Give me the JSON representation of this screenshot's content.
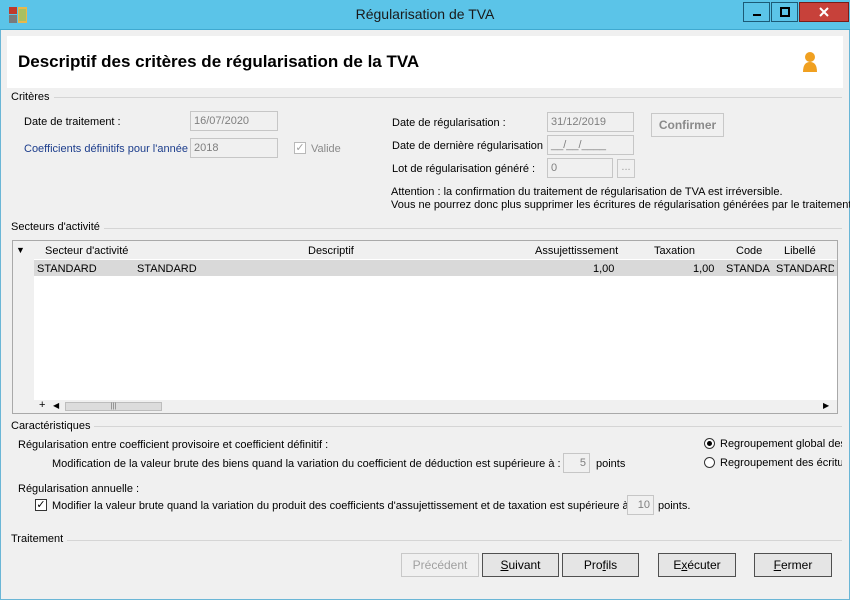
{
  "window": {
    "title": "Régularisation de TVA",
    "minimize_glyph": "▁",
    "maximize_glyph": "□",
    "close_glyph": "✕"
  },
  "header": {
    "title": "Descriptif des critères de régularisation de la TVA",
    "icon": "user-icon"
  },
  "criteres": {
    "group_label": "Critères",
    "date_traitement_label": "Date de traitement :",
    "date_traitement_value": "16/07/2020",
    "coeff_label": "Coefficients définitifs pour l'année :",
    "coeff_value": "2018",
    "valide_label": "Valide",
    "valide_checked": true,
    "date_regul_label": "Date de régularisation :",
    "date_regul_value": "31/12/2019",
    "confirm_label": "Confirmer",
    "date_derniere_label": "Date de dernière régularisation :",
    "date_derniere_value": "__/__/____",
    "lot_label": "Lot de régularisation généré :",
    "lot_value": "0",
    "lot_browse_label": "...",
    "warning_line1": "Attention : la confirmation du traitement de régularisation de TVA est irréversible.",
    "warning_line2": "Vous ne pourrez donc plus supprimer les écritures de régularisation générées par le traitement."
  },
  "secteurs": {
    "group_label": "Secteurs d'activité",
    "menu_glyph": "▼",
    "columns": [
      "Secteur d'activité",
      "Descriptif",
      "Assujettissement",
      "Taxation",
      "Code",
      "Libellé"
    ],
    "rows": [
      [
        "STANDARD",
        "STANDARD",
        "1,00",
        "1,00",
        "STANDA",
        "STANDARD"
      ]
    ],
    "scroll_add": "+",
    "scroll_left": "◀",
    "scroll_right": "▶",
    "scroll_thumb": "|||"
  },
  "caracteristiques": {
    "group_label": "Caractéristiques",
    "provisoire_label": "Régularisation entre coefficient provisoire et coefficient définitif :",
    "modif_label": "Modification de la valeur brute des biens quand la variation du coefficient de déduction est supérieure à :",
    "modif_value": "5",
    "points_label": "points",
    "radio_global": "Regroupement global des",
    "radio_ecritures": "Regroupement des écritur",
    "radio_selected": "global",
    "annuelle_label": "Régularisation annuelle :",
    "annuelle_check_label": "Modifier la valeur brute quand la variation du produit des coefficients d'assujettissement et de taxation est supérieure à :",
    "annuelle_checked": true,
    "annuelle_value": "10",
    "annuelle_points": "points."
  },
  "traitement": {
    "group_label": "Traitement",
    "buttons": {
      "precedent": "Précédent",
      "suivant_pre": "",
      "suivant_u": "S",
      "suivant_post": "uivant",
      "profils_pre": "Pro",
      "profils_u": "f",
      "profils_post": "ils",
      "executer_pre": "E",
      "executer_u": "x",
      "executer_post": "écuter",
      "fermer_pre": "",
      "fermer_u": "F",
      "fermer_post": "ermer"
    }
  }
}
